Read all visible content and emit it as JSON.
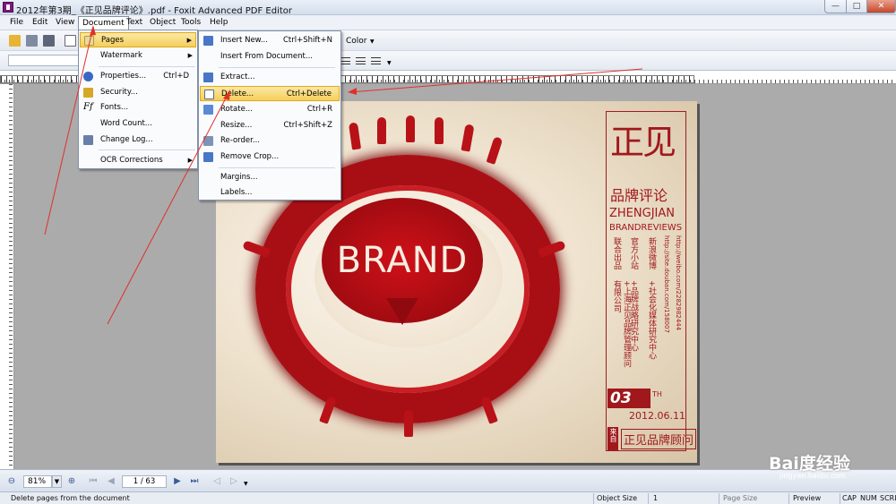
{
  "window": {
    "title": "2012年第3期_《正见品牌评论》.pdf - Foxit Advanced PDF Editor",
    "min": "—",
    "max": "□",
    "close": "✕"
  },
  "menubar": [
    "File",
    "Edit",
    "View",
    "Document",
    "Text",
    "Object",
    "Tools",
    "Help"
  ],
  "toolbar": {
    "color_label": "Color"
  },
  "document_menu": [
    {
      "label": "Pages",
      "shortcut": "",
      "submenu": true,
      "icon": "pages-icon",
      "highlight": true
    },
    {
      "label": "Watermark",
      "shortcut": "",
      "submenu": true,
      "icon": ""
    },
    {
      "label": "Properties...",
      "shortcut": "Ctrl+D",
      "icon": "info-icon"
    },
    {
      "label": "Security...",
      "shortcut": "",
      "icon": "lock-icon"
    },
    {
      "label": "Fonts...",
      "shortcut": "",
      "icon": "font-icon"
    },
    {
      "label": "Word Count...",
      "shortcut": "",
      "icon": ""
    },
    {
      "label": "Change Log...",
      "shortcut": "",
      "icon": "log-icon"
    },
    {
      "label": "OCR Corrections",
      "shortcut": "",
      "submenu": true,
      "icon": ""
    }
  ],
  "pages_submenu": [
    {
      "label": "Insert New...",
      "shortcut": "Ctrl+Shift+N",
      "icon": "insert-page-icon"
    },
    {
      "label": "Insert From Document...",
      "shortcut": "",
      "icon": ""
    },
    {
      "label": "Extract...",
      "shortcut": "",
      "icon": "extract-icon"
    },
    {
      "label": "Delete...",
      "shortcut": "Ctrl+Delete",
      "icon": "delete-page-icon",
      "highlight": true
    },
    {
      "label": "Rotate...",
      "shortcut": "Ctrl+R",
      "icon": "rotate-icon"
    },
    {
      "label": "Resize...",
      "shortcut": "Ctrl+Shift+Z",
      "icon": ""
    },
    {
      "label": "Re-order...",
      "shortcut": "",
      "icon": "reorder-icon"
    },
    {
      "label": "Remove Crop...",
      "shortcut": "",
      "icon": "crop-icon"
    },
    {
      "label": "Margins...",
      "shortcut": "",
      "icon": ""
    },
    {
      "label": "Labels...",
      "shortcut": "",
      "icon": ""
    }
  ],
  "cover": {
    "brand": "BRAND",
    "title": "正见",
    "subtitle": "品牌评论",
    "en1": "ZHENGJIAN",
    "en2": "BRANDREVIEWS",
    "col1": "联合出品",
    "col2": "官方小站",
    "col3": "新浪微博",
    "col1b": "+上海正见品牌管理顾问有限公司",
    "col2b": "+品牌战略研究中心",
    "col3b": "+社会化媒体研究中心",
    "url1": "http://site.douban.com/158007",
    "url2": "http://weibo.com/2282982444",
    "issue": "03",
    "issue_suffix": "TH",
    "date": "2012.06.11",
    "from": "来自",
    "firm": "正见品牌顾问"
  },
  "nav": {
    "zoom": "81%",
    "page": "1 / 63"
  },
  "status": {
    "message": "Delete pages from the document",
    "object_size_label": "Object Size",
    "object_size_value": "1",
    "page_size_label": "Page Size",
    "preview": "Preview",
    "cap": "CAP",
    "num": "NUM",
    "scrl": "SCRL"
  },
  "watermark": {
    "text": "Bai度经验",
    "url": "jingyan.baidu.com"
  },
  "colors": {
    "highlight": "#f5cf5a",
    "brand_red": "#a0181c",
    "annotation_arrow": "#e0302a"
  }
}
